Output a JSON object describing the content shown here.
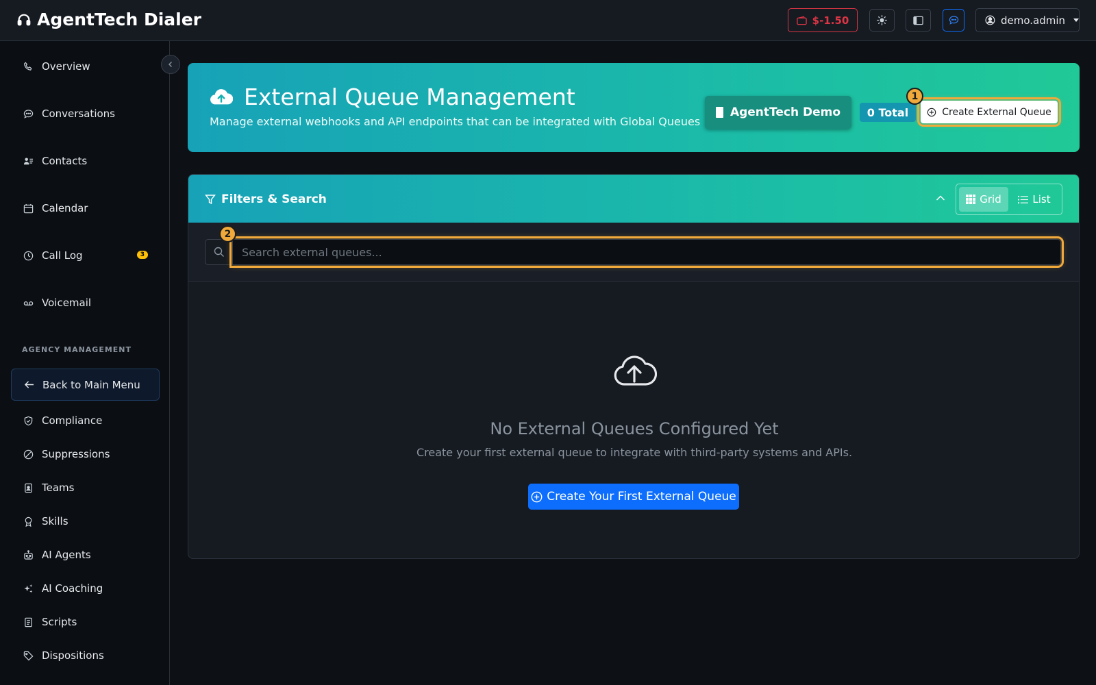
{
  "app": {
    "brand": "AgentTech Dialer",
    "balance": "$-1.50",
    "user": "demo.admin"
  },
  "sidebar": {
    "items": [
      {
        "label": "Overview",
        "icon": "phone-icon"
      },
      {
        "label": "Conversations",
        "icon": "chat-icon"
      },
      {
        "label": "Contacts",
        "icon": "contacts-icon"
      },
      {
        "label": "Calendar",
        "icon": "calendar-icon"
      },
      {
        "label": "Call Log",
        "icon": "clock-icon",
        "badge": "3"
      },
      {
        "label": "Voicemail",
        "icon": "voicemail-icon"
      }
    ],
    "section_label": "AGENCY MANAGEMENT",
    "back_label": "Back to Main Menu",
    "agency_items": [
      {
        "label": "Compliance",
        "icon": "shield-icon"
      },
      {
        "label": "Suppressions",
        "icon": "ban-icon"
      },
      {
        "label": "Teams",
        "icon": "badge-icon"
      },
      {
        "label": "Skills",
        "icon": "award-icon"
      },
      {
        "label": "AI Agents",
        "icon": "robot-icon"
      },
      {
        "label": "AI Coaching",
        "icon": "sparkles-icon"
      },
      {
        "label": "Scripts",
        "icon": "document-icon"
      },
      {
        "label": "Dispositions",
        "icon": "tag-icon"
      }
    ]
  },
  "header": {
    "title": "External Queue Management",
    "subtitle": "Manage external webhooks and API endpoints that can be integrated with Global Queues",
    "org_label": "AgentTech Demo",
    "total_label": "0 Total",
    "create_label": "Create External Queue"
  },
  "filters": {
    "title": "Filters & Search",
    "grid_label": "Grid",
    "list_label": "List",
    "search_placeholder": "Search external queues..."
  },
  "empty_state": {
    "title": "No External Queues Configured Yet",
    "subtitle": "Create your first external queue to integrate with third-party systems and APIs.",
    "button_label": "Create Your First External Queue"
  },
  "markers": {
    "one": "1",
    "two": "2"
  },
  "colors": {
    "accent_teal": "#17a2b8",
    "accent_green": "#20c997",
    "primary_blue": "#0d6efd",
    "danger": "#dc3545",
    "highlight": "#f0a93a"
  }
}
